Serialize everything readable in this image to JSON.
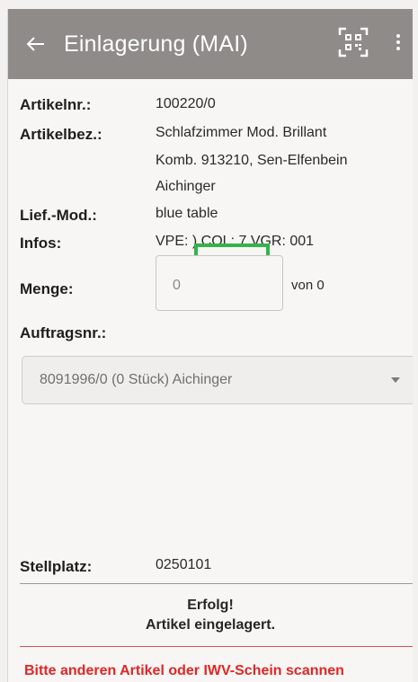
{
  "appbar": {
    "title": "Einlagerung (MAI)",
    "back_icon": "arrow-left-icon",
    "scan_icon": "qr-code-icon",
    "menu_icon": "more-vert-icon",
    "background_color": "#8e8b88"
  },
  "article": {
    "number_label": "Artikelnr.:",
    "number_value": "100220/0",
    "desc_label": "Artikelbez.:",
    "desc_line1": "Schlafzimmer Mod. Brillant",
    "desc_line2": "Komb. 913210, Sen-Elfenbein",
    "desc_line3": "Aichinger",
    "supplier_label": "Lief.-Mod.:",
    "supplier_value": "blue table",
    "infos_label": "Infos:",
    "infos_value": "VPE: ) COL: 7 VGR: 001",
    "highlight_color": "#35b34a"
  },
  "quantity": {
    "label": "Menge:",
    "value": "0",
    "of_text": "von 0"
  },
  "order": {
    "label": "Auftragsnr.:",
    "selected": "8091996/0 (0 Stück) Aichinger"
  },
  "location": {
    "label": "Stellplatz:",
    "value": "0250101"
  },
  "status": {
    "title": "Erfolg!",
    "message": "Artikel eingelagert.",
    "scan_prompt": "Bitte anderen Artikel oder IWV-Schein scannen",
    "prompt_color": "#e02626"
  }
}
